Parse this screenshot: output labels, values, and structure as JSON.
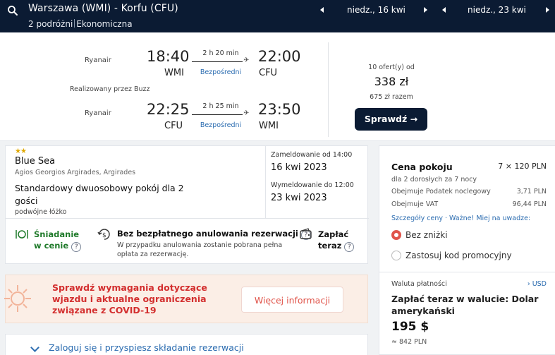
{
  "header": {
    "route": "Warszawa (WMI) - Korfu (CFU)",
    "travelers": "2 podróżni",
    "cabin": "Ekonomiczna",
    "depart_date": "niedz., 16 kwi",
    "return_date": "niedz., 23 kwi"
  },
  "flight": {
    "outbound": {
      "airline": "Ryanair",
      "dep_time": "18:40",
      "dep_code": "WMI",
      "duration": "2 h 20 min",
      "stops": "Bezpośredni",
      "arr_time": "22:00",
      "arr_code": "CFU"
    },
    "operated_by": "Realizowany przez Buzz",
    "inbound": {
      "airline": "Ryanair",
      "dep_time": "22:25",
      "dep_code": "CFU",
      "duration": "2 h 25 min",
      "stops": "Bezpośredni",
      "arr_time": "23:50",
      "arr_code": "WMI"
    },
    "offers": "10 ofert(y) od",
    "price": "338 zł",
    "total": "675 zł razem",
    "check_label": "Sprawdź →"
  },
  "hotel": {
    "stars": "★★",
    "name": "Blue Sea",
    "address": "Agios Georgios Argirades, Argirades",
    "room": "Standardowy dwuosobowy pokój dla 2 gości",
    "bed": "podwójne łóżko",
    "checkin_label": "Zameldowanie od 14:00",
    "checkin_date": "16 kwi 2023",
    "checkout_label": "Wymeldowanie do 12:00",
    "checkout_date": "23 kwi 2023",
    "breakfast_l1": "Śniadanie",
    "breakfast_l2": "w cenie",
    "cancel_title": "Bez bezpłatnego anulowania rezerwacji",
    "cancel_desc": "W przypadku anulowania zostanie pobrana pełna opłata za rezerwację.",
    "pay_l1": "Zapłać",
    "pay_l2": "teraz",
    "help": "?"
  },
  "covid": {
    "text": "Sprawdź wymagania dotyczące wjazdu i aktualne ograniczenia związane z COVID-19",
    "button": "Więcej informacji"
  },
  "login": {
    "text": "Zaloguj się i przyspiesz składanie rezerwacji"
  },
  "pricing": {
    "title": "Cena pokoju",
    "value": "7 × 120 PLN",
    "sub": "dla 2 dorosłych  za 7 nocy",
    "tax_label": "Obejmuje Podatek noclegowy",
    "tax_value": "3,71 PLN",
    "vat_label": "Obejmuje VAT",
    "vat_value": "96,44 PLN",
    "links": "Szczegóły ceny  ·  Ważne! Miej na uwadze:",
    "opt1": "Bez zniżki",
    "opt2": "Zastosuj kod promocyjny",
    "currency_label": "Waluta płatności",
    "currency_value": "› USD",
    "pay_title": "Zapłać teraz w walucie: Dolar amerykański",
    "big_price": "195 $",
    "pln": "≈ 842 PLN"
  }
}
